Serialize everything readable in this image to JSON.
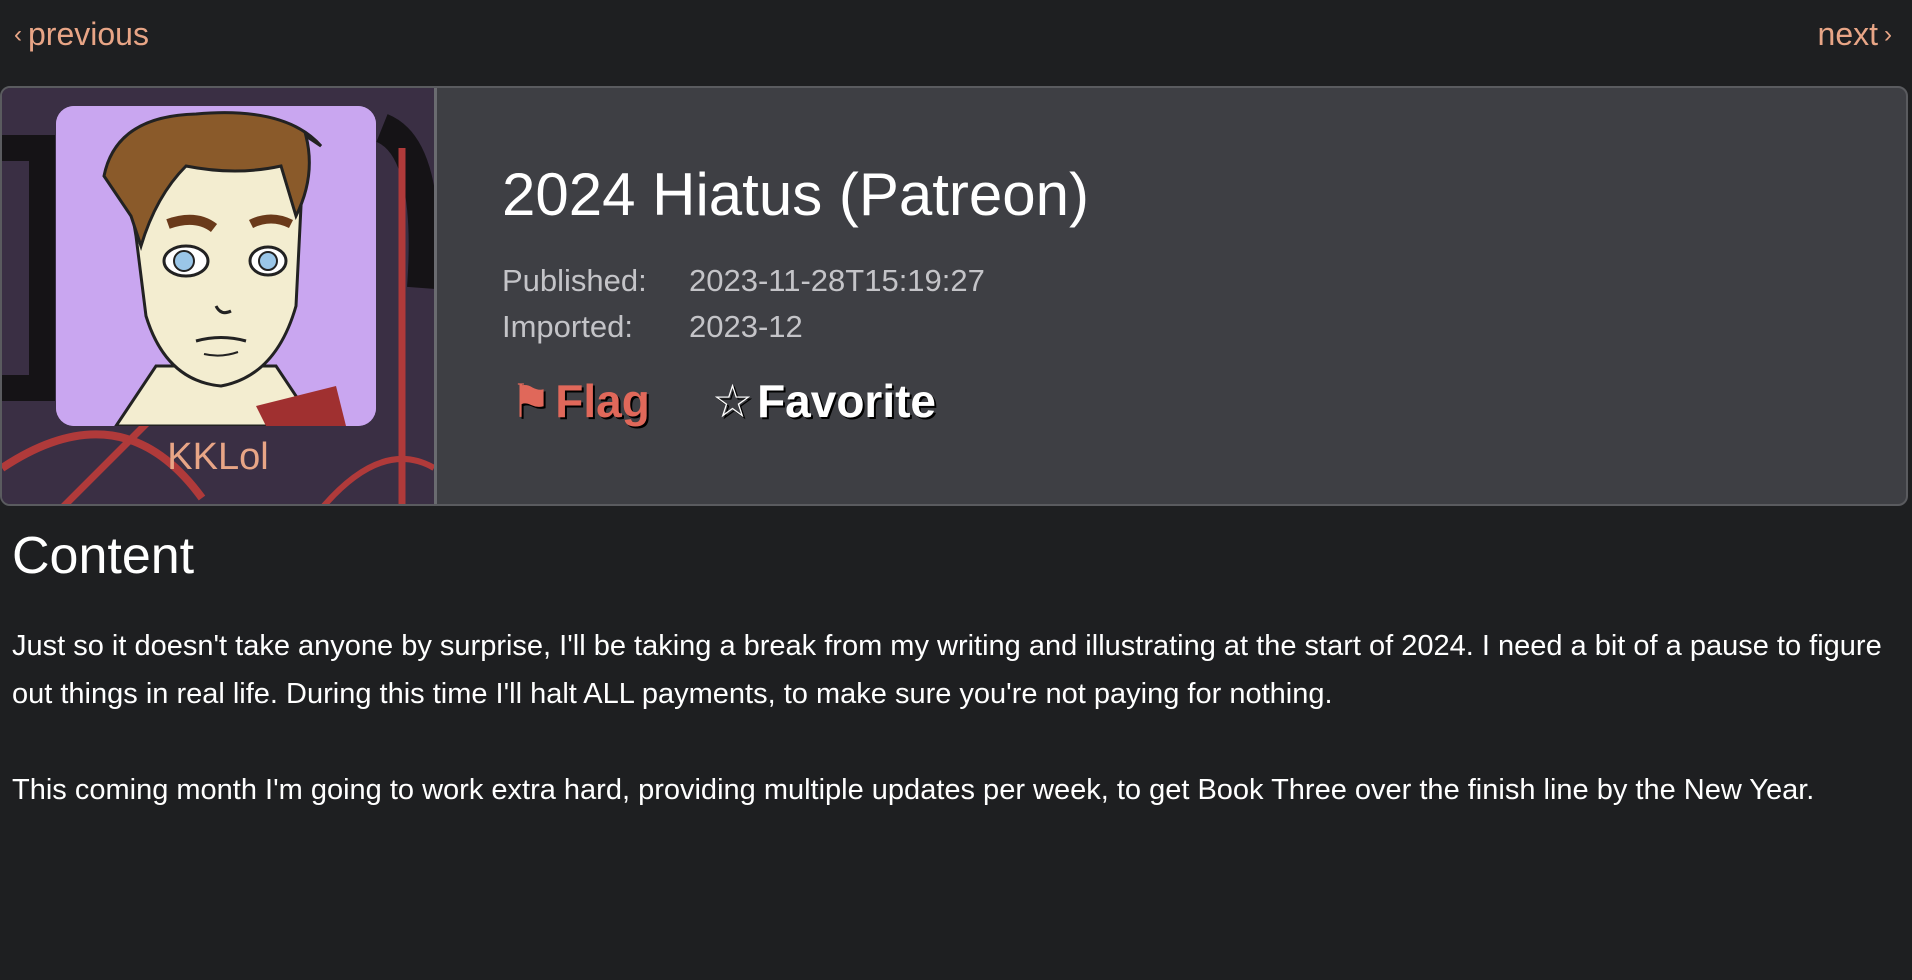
{
  "nav": {
    "previous_label": "previous",
    "next_label": "next",
    "prev_chevron": "‹",
    "next_chevron": "›"
  },
  "user": {
    "name": "KKLol",
    "avatar_icon": "avatar-portrait",
    "banner_colors": {
      "background": "#3a2f44",
      "accent": "#b03a3a"
    }
  },
  "post": {
    "title": "2024 Hiatus (Patreon)",
    "published_label": "Published:",
    "published_value": "2023-11-28T15:19:27",
    "imported_label": "Imported:",
    "imported_value": "2023-12"
  },
  "actions": {
    "flag_icon": "⚑",
    "flag_label": "Flag",
    "favorite_icon": "☆",
    "favorite_label": "Favorite"
  },
  "content": {
    "heading": "Content",
    "paragraphs": [
      "Just so it doesn't take anyone by surprise, I'll be taking a break from my writing and illustrating at the start of 2024. I need a bit of a pause to figure out things in real life. During this time I'll halt ALL payments, to make sure you're not paying for nothing.",
      "This coming month I'm going to work extra hard, providing multiple updates per week, to get Book Three over the finish line by the New Year."
    ]
  },
  "colors": {
    "page_bg": "#1e1f21",
    "card_bg": "#3e3f44",
    "link": "#e8a586",
    "flag": "#e0685a",
    "avatar_bg": "#c9a6f0"
  }
}
